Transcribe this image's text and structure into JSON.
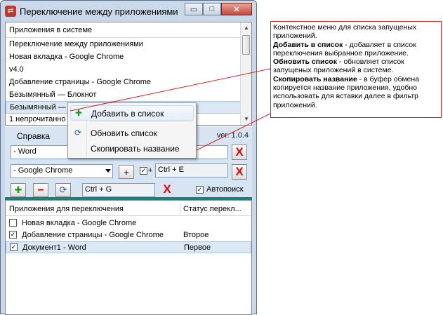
{
  "window": {
    "title": "Переключение между приложениями",
    "app_icon": "app-icon",
    "minimize_glyph": "▭",
    "maximize_glyph": "□",
    "close_glyph": "✕"
  },
  "system_list": {
    "header": "Приложения в системе",
    "items": [
      "Переключение между приложениями",
      "Новая вкладка - Google Chrome",
      "v4.0",
      "Добавление страницы - Google Chrome",
      "Безымянный — Блокнот",
      "Безымянный — Б",
      "1 непрочитанно"
    ],
    "selected_index": 5
  },
  "context_menu": {
    "items": [
      {
        "label": "Добавить в список",
        "icon": "add-green-icon",
        "glyph": "✚"
      },
      {
        "label": "Обновить список",
        "icon": "refresh-icon",
        "glyph": "⟳"
      },
      {
        "label": "Скопировать название",
        "icon": "",
        "glyph": ""
      }
    ]
  },
  "panel": {
    "help": "Справка",
    "version": "ver. 1.0.4",
    "target_field": "- Word",
    "source_combo": "- Google Chrome",
    "plus_glyph": "+",
    "hotkey_checkbox": "✓",
    "hotkey": "Ctrl + E",
    "global_hotkey": "Ctrl + G",
    "autosearch_label": "Автопоиск",
    "autosearch_checked": "✓",
    "x_glyph": "X",
    "add_glyph": "✚",
    "remove_glyph": "━",
    "refresh_glyph": "⟳"
  },
  "switch_list": {
    "col_app": "Приложения для переключения",
    "col_status": "Статус перекл...",
    "rows": [
      {
        "name": "Новая вкладка - Google Chrome",
        "status": "",
        "checked": ""
      },
      {
        "name": "Добавление страницы - Google Chrome",
        "status": "Второе",
        "checked": "✓"
      },
      {
        "name": "Документ1 - Word",
        "status": "Первое",
        "checked": "✓"
      }
    ],
    "selected_index": 2
  },
  "note": {
    "intro": "Контекстное меню для списка запущеных приложений.",
    "add_term": "Добавить в список",
    "add_desc": " - добавляет в список переключения выбранное приложение.",
    "refresh_term": "Обновить список",
    "refresh_desc": " - обновляет список запущеных приложений в системе.",
    "copy_term": "Скопировать название",
    "copy_desc": " - в буфер обмена копируется название приложения, удобно использовать для вставки далее в фильтр приложений."
  },
  "colors": {
    "accent_red": "#dd2222",
    "teal_divider": "#1f7f78",
    "window_frame": "#c9d9ea"
  }
}
